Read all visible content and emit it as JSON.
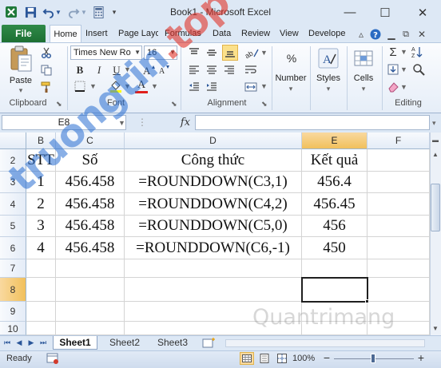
{
  "window": {
    "title": "Book1 - Microsoft Excel",
    "minimize": "—",
    "maximize": "☐",
    "close": "✕"
  },
  "quick_access": {
    "save_icon": "floppy-disk",
    "undo_icon": "undo-arrow",
    "redo_icon": "redo-arrow",
    "calculator_icon": "calculator"
  },
  "ribbon_tabs": [
    {
      "label": "File"
    },
    {
      "label": "Home"
    },
    {
      "label": "Insert"
    },
    {
      "label": "Page Layo"
    },
    {
      "label": "Formulas"
    },
    {
      "label": "Data"
    },
    {
      "label": "Review"
    },
    {
      "label": "View"
    },
    {
      "label": "Develope"
    }
  ],
  "ribbon": {
    "clipboard": {
      "paste_label": "Paste",
      "group_label": "Clipboard"
    },
    "font": {
      "name": "Times New Ro",
      "size": "16",
      "bold": "B",
      "italic": "I",
      "underline": "U",
      "font_color": "A",
      "group_label": "Font"
    },
    "alignment": {
      "group_label": "Alignment"
    },
    "number": {
      "label": "Number",
      "percent": "%"
    },
    "styles": {
      "label": "Styles"
    },
    "cells": {
      "label": "Cells"
    },
    "editing": {
      "sum_icon": "Σ",
      "group_label": "Editing"
    }
  },
  "formula_bar": {
    "name_box": "E8",
    "fx_label": "fx",
    "value": ""
  },
  "sheet": {
    "columns": [
      "B",
      "C",
      "D",
      "E",
      "F"
    ],
    "selected_column": "E",
    "rows": [
      {
        "number": "2",
        "cells": [
          "STT",
          "Số",
          "Công thức",
          "Kết quả",
          ""
        ]
      },
      {
        "number": "3",
        "cells": [
          "1",
          "456.458",
          "=ROUNDDOWN(C3,1)",
          "456.4",
          ""
        ]
      },
      {
        "number": "4",
        "cells": [
          "2",
          "456.458",
          "=ROUNDDOWN(C4,2)",
          "456.45",
          ""
        ]
      },
      {
        "number": "5",
        "cells": [
          "3",
          "456.458",
          "=ROUNDDOWN(C5,0)",
          "456",
          ""
        ]
      },
      {
        "number": "6",
        "cells": [
          "4",
          "456.458",
          "=ROUNDDOWN(C6,-1)",
          "450",
          ""
        ]
      },
      {
        "number": "7",
        "cells": [
          "",
          "",
          "",
          "",
          ""
        ]
      },
      {
        "number": "8",
        "cells": [
          "",
          "",
          "",
          "",
          ""
        ]
      },
      {
        "number": "9",
        "cells": [
          "",
          "",
          "",
          "",
          ""
        ]
      },
      {
        "number": "10",
        "cells": [
          "",
          "",
          "",
          "",
          ""
        ]
      }
    ],
    "selected_row": "8",
    "selected_cell": "E8"
  },
  "sheet_tabs": {
    "tabs": [
      "Sheet1",
      "Sheet2",
      "Sheet3"
    ],
    "active": "Sheet1"
  },
  "status_bar": {
    "status": "Ready",
    "zoom": "100%",
    "zoom_out": "−",
    "zoom_in": "+"
  },
  "watermarks": {
    "site1_part1": "truongtin",
    "site1_part2": ".top",
    "site2": "Quantrimang"
  }
}
